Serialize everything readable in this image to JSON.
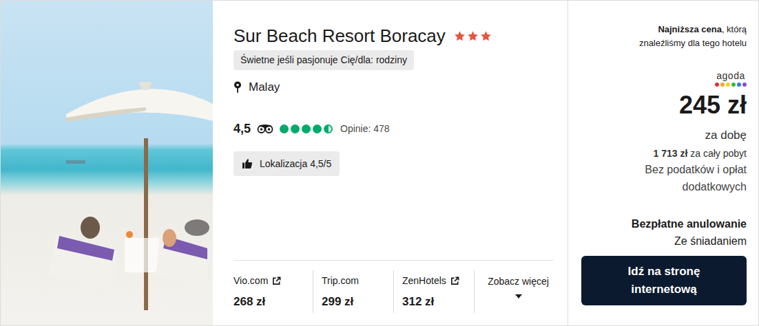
{
  "hotel": {
    "name": "Sur Beach Resort Boracay",
    "stars": 3,
    "tag": "Świetne jeśli pasjonuje Cię/dla: rodziny",
    "location": "Malay",
    "rating": {
      "score": "4,5",
      "stars": 4.5,
      "reviews": "Opinie: 478"
    },
    "location_score": "Lokalizacja 4,5/5"
  },
  "providers": [
    {
      "name": "Vio.com",
      "price": "268 zł",
      "external": true
    },
    {
      "name": "Trip.com",
      "price": "299 zł",
      "external": false
    },
    {
      "name": "ZenHotels",
      "price": "312 zł",
      "external": true
    }
  ],
  "more": {
    "label": "Zobacz więcej"
  },
  "offer": {
    "lowest_bold": "Najniższa cena",
    "lowest_rest": ", którą znaleźliśmy dla tego hotelu",
    "provider": "agoda",
    "price": "245 zł",
    "per": "za dobę",
    "total_bold": "1 713 zł",
    "total_rest": " za cały pobyt",
    "taxes": "Bez podatków i opłat dodatkowych",
    "cancellation": "Bezpłatne anulowanie",
    "meal": "Ze śniadaniem",
    "button": "Idź na stronę internetową"
  }
}
